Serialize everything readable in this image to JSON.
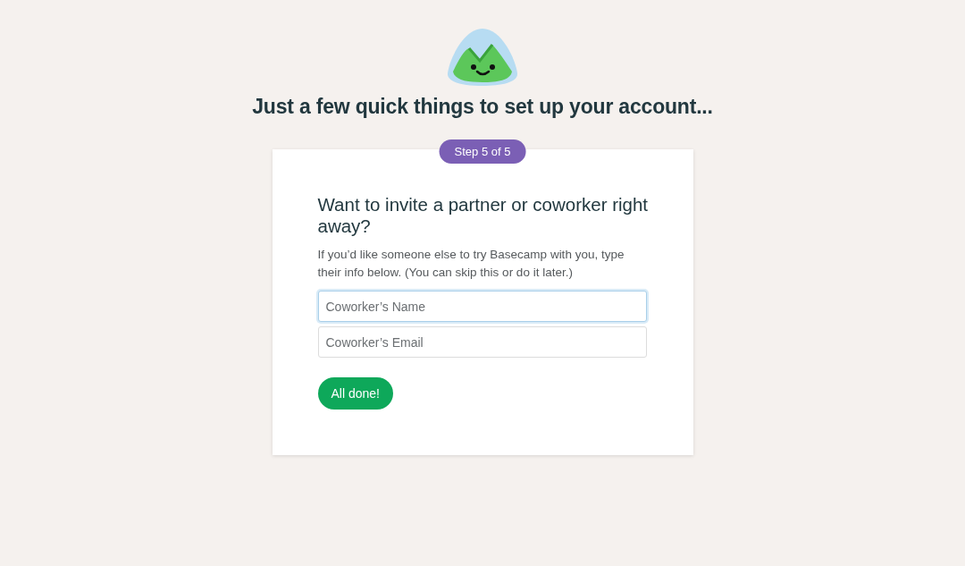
{
  "page_title": "Just a few quick things to set up your account...",
  "step_badge": "Step 5 of 5",
  "card": {
    "heading": "Want to invite a partner or coworker right away?",
    "description": "If you’d like someone else to try Basecamp with you, type their info below. (You can skip this or do it later.)",
    "fields": [
      {
        "placeholder": "Coworker’s Name",
        "focused": true
      },
      {
        "placeholder": "Coworker’s Email",
        "focused": false
      }
    ],
    "submit_button": "All done!"
  }
}
